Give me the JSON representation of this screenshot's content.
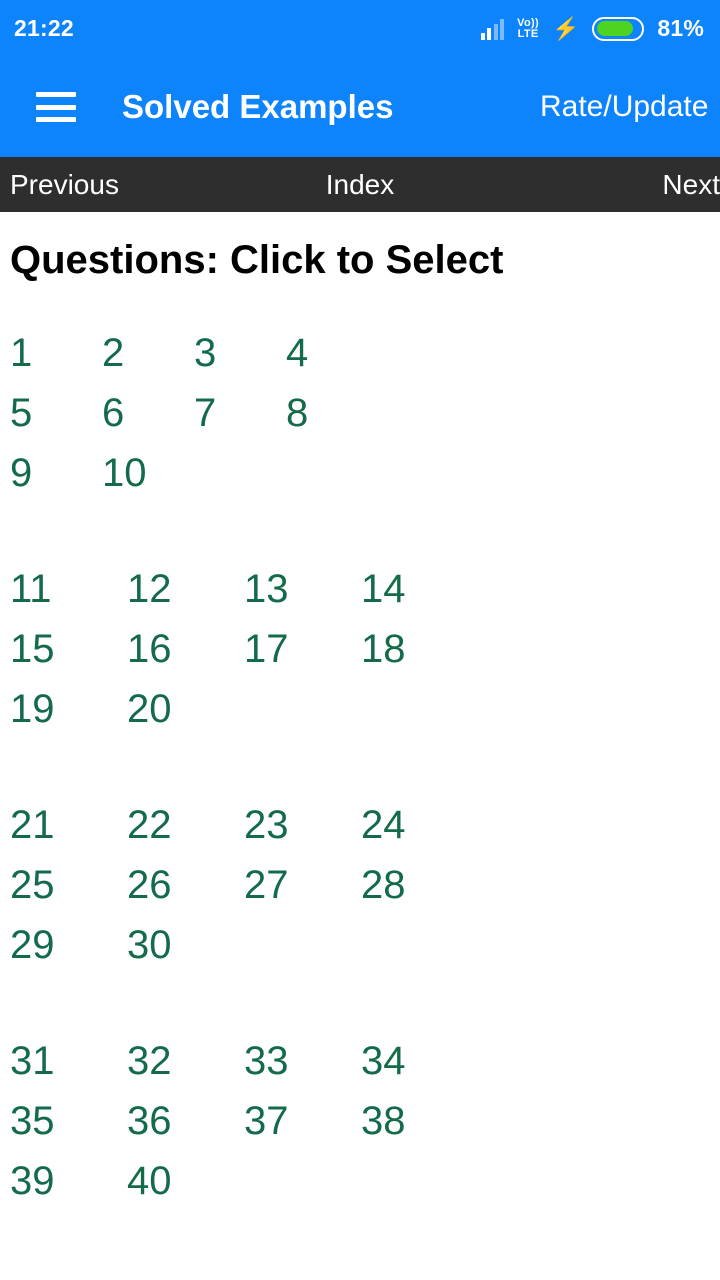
{
  "status_bar": {
    "time": "21:22",
    "network_label": "Vo))",
    "network_type": "LTE",
    "battery_percent": "81%",
    "icons": {
      "signal": "signal-bars-icon",
      "volte": "volte-icon",
      "charging": "charging-bolt-icon",
      "battery": "battery-icon"
    },
    "colors": {
      "bar_background": "#0d84fb",
      "battery_fill": "#4ed320",
      "text": "#ffffff"
    }
  },
  "app_bar": {
    "menu_icon": "hamburger-menu-icon",
    "title": "Solved Examples",
    "action_label": "Rate/Update",
    "background": "#0d84fb"
  },
  "nav_bar": {
    "previous_label": "Previous",
    "index_label": "Index",
    "next_label": "Next",
    "background": "#2e2e2e"
  },
  "main": {
    "heading": "Questions: Click to Select",
    "link_color": "#146b4a",
    "groups": [
      {
        "rows": [
          [
            "1",
            "2",
            "3",
            "4"
          ],
          [
            "5",
            "6",
            "7",
            "8"
          ],
          [
            "9",
            "10"
          ]
        ]
      },
      {
        "rows": [
          [
            "11",
            "12",
            "13",
            "14"
          ],
          [
            "15",
            "16",
            "17",
            "18"
          ],
          [
            "19",
            "20"
          ]
        ]
      },
      {
        "rows": [
          [
            "21",
            "22",
            "23",
            "24"
          ],
          [
            "25",
            "26",
            "27",
            "28"
          ],
          [
            "29",
            "30"
          ]
        ]
      },
      {
        "rows": [
          [
            "31",
            "32",
            "33",
            "34"
          ],
          [
            "35",
            "36",
            "37",
            "38"
          ],
          [
            "39",
            "40"
          ]
        ]
      }
    ]
  }
}
